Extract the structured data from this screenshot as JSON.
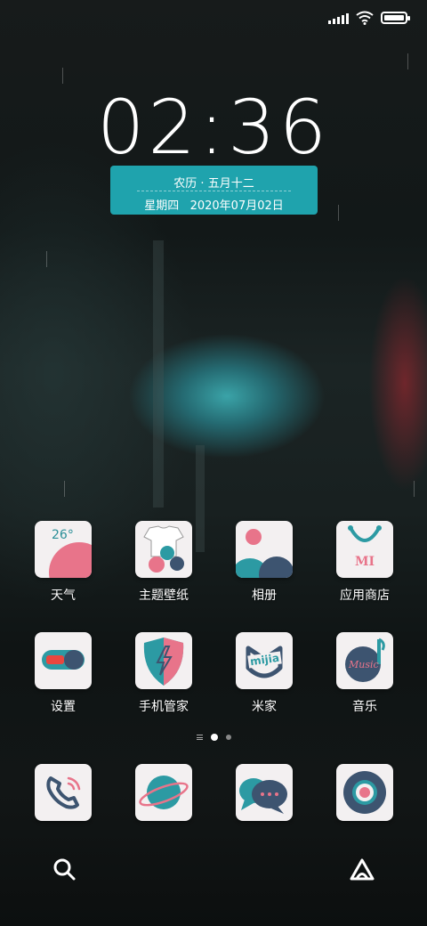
{
  "status_bar": {
    "icons": [
      "signal-icon",
      "wifi-icon",
      "battery-icon"
    ],
    "battery_level": 1.0
  },
  "clock": {
    "time": "02:36"
  },
  "date_widget": {
    "lunar": "农历 · 五月十二",
    "solar": "星期四   2020年07月02日"
  },
  "apps": [
    {
      "label": "天气",
      "icon": "weather-icon",
      "temp": "26°"
    },
    {
      "label": "主题壁纸",
      "icon": "theme-wallpaper-icon"
    },
    {
      "label": "相册",
      "icon": "gallery-icon"
    },
    {
      "label": "应用商店",
      "icon": "app-store-icon",
      "badge_text": "MI"
    },
    {
      "label": "设置",
      "icon": "settings-toggle-icon"
    },
    {
      "label": "手机管家",
      "icon": "security-shield-icon"
    },
    {
      "label": "米家",
      "icon": "mijia-icon",
      "badge_text": "mijia"
    },
    {
      "label": "音乐",
      "icon": "music-icon",
      "badge_text": "Music"
    }
  ],
  "page_indicator": {
    "pages": 2,
    "current": 1
  },
  "dock": [
    {
      "icon": "phone-icon"
    },
    {
      "icon": "browser-planet-icon"
    },
    {
      "icon": "messages-icon"
    },
    {
      "icon": "camera-icon"
    }
  ],
  "bottom_bar": [
    {
      "icon": "search-icon"
    },
    {
      "icon": "assistant-icon"
    }
  ],
  "colors": {
    "accent": "#1fa3ad",
    "pink": "#e8748a",
    "navy": "#3d5470",
    "icon_bg": "#f3f0f1"
  }
}
